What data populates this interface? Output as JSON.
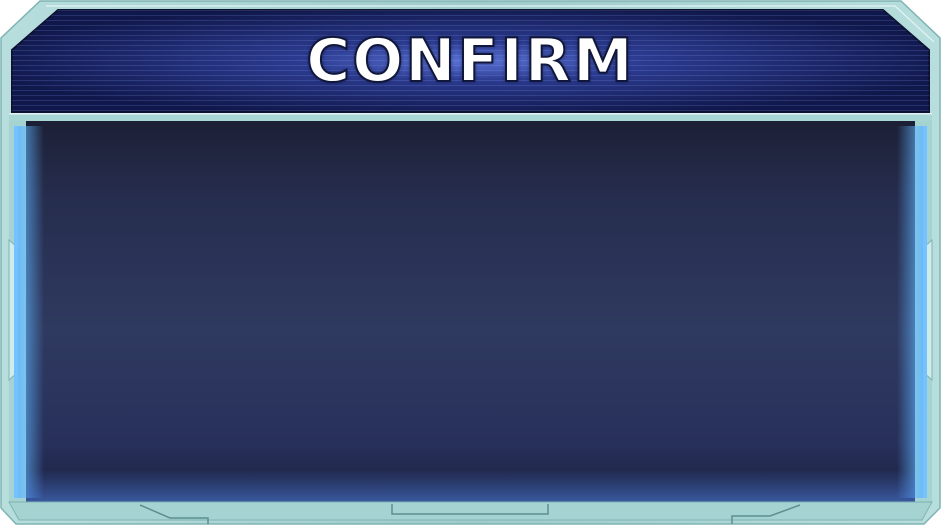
{
  "dialog": {
    "title": "CONFIRM"
  },
  "colors": {
    "frame": "#9fcfcf",
    "frame_light": "#c4e6e4",
    "header_dark": "#121a4c",
    "header_glow": "#4a63c2",
    "panel_top": "#1d2138",
    "panel_mid": "#2f3a60",
    "side_glow": "#4aa8ff"
  }
}
